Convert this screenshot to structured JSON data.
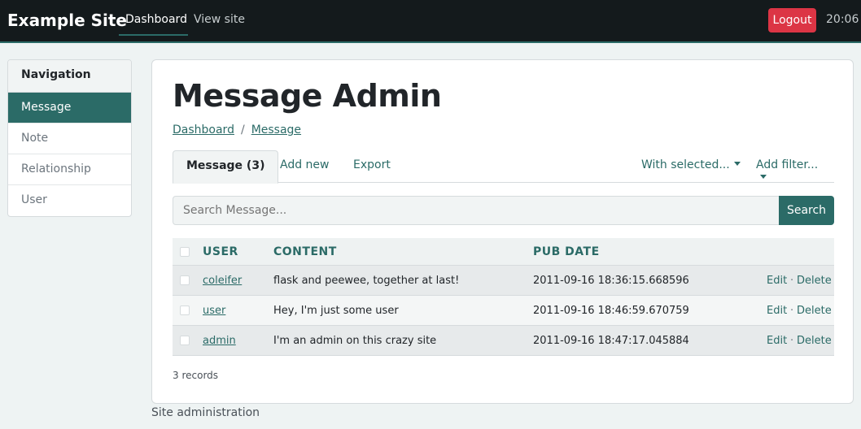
{
  "navbar": {
    "brand": "Example Site",
    "links": [
      {
        "label": "Dashboard",
        "active": true
      },
      {
        "label": "View site",
        "active": false
      }
    ],
    "logout_label": "Logout",
    "clock": "20:06"
  },
  "sidebar": {
    "header": "Navigation",
    "items": [
      {
        "label": "Message",
        "active": true
      },
      {
        "label": "Note",
        "active": false
      },
      {
        "label": "Relationship",
        "active": false
      },
      {
        "label": "User",
        "active": false
      }
    ]
  },
  "main": {
    "title": "Message Admin",
    "breadcrumb": [
      "Dashboard",
      "Message"
    ],
    "tabs": [
      {
        "label": "Message (3)",
        "active": true
      },
      {
        "label": "Add new",
        "active": false
      },
      {
        "label": "Export",
        "active": false
      }
    ],
    "actions": {
      "with_selected": "With selected...",
      "add_filter": "Add filter..."
    },
    "search": {
      "placeholder": "Search Message...",
      "button_label": "Search"
    },
    "table": {
      "columns": [
        "USER",
        "CONTENT",
        "PUB DATE"
      ],
      "rows": [
        {
          "user": "coleifer",
          "content": "flask and peewee, together at last!",
          "pub_date": "2011-09-16 18:36:15.668596"
        },
        {
          "user": "user",
          "content": "Hey, I'm just some user",
          "pub_date": "2011-09-16 18:46:59.670759"
        },
        {
          "user": "admin",
          "content": "I'm an admin on this crazy site",
          "pub_date": "2011-09-16 18:47:17.045884"
        }
      ],
      "edit_label": "Edit",
      "delete_label": "Delete",
      "action_separator": "·"
    },
    "records": "3 records"
  },
  "footer": "Site administration",
  "colors": {
    "accent": "#2b6b67",
    "navbar": "#141a1c",
    "danger": "#dc3545"
  }
}
